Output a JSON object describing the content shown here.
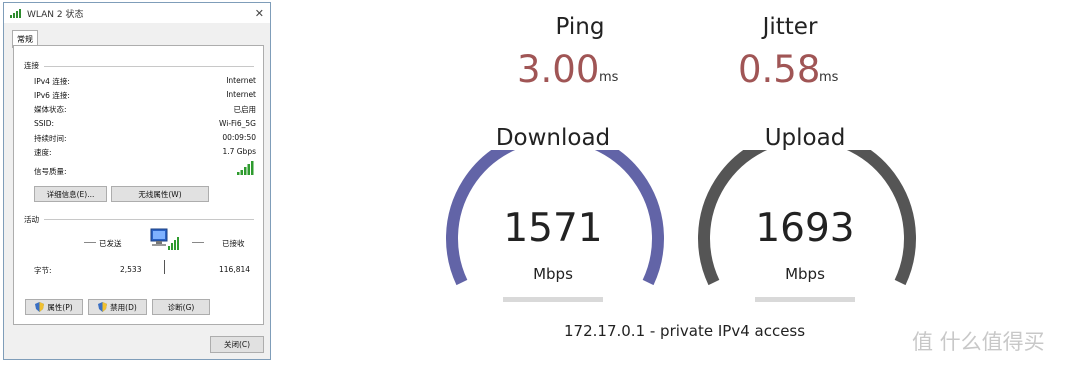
{
  "dialog": {
    "title": "WLAN 2 状态",
    "tab": "常规",
    "connection_group": "连接",
    "rows": [
      {
        "label": "IPv4 连接:",
        "value": "Internet"
      },
      {
        "label": "IPv6 连接:",
        "value": "Internet"
      },
      {
        "label": "媒体状态:",
        "value": "已启用"
      },
      {
        "label": "SSID:",
        "value": "Wi-Fi6_5G"
      },
      {
        "label": "持续时间:",
        "value": "00:09:50"
      },
      {
        "label": "速度:",
        "value": "1.7 Gbps"
      },
      {
        "label": "信号质量:",
        "value": ""
      }
    ],
    "details_button": "详细信息(E)...",
    "wireless_props_button": "无线属性(W)",
    "activity_group": "活动",
    "sent_label": "已发送",
    "received_label": "已接收",
    "bytes_label": "字节:",
    "bytes_sent": "2,533",
    "bytes_received": "116,814",
    "properties_button": "属性(P)",
    "disable_button": "禁用(D)",
    "diagnose_button": "诊断(G)",
    "close_button": "关闭(C)"
  },
  "speedtest": {
    "ping_label": "Ping",
    "ping_value": "3.00",
    "ping_unit": "ms",
    "jitter_label": "Jitter",
    "jitter_value": "0.58",
    "jitter_unit": "ms",
    "download_label": "Download",
    "download_value": "1571",
    "download_unit": "Mbps",
    "upload_label": "Upload",
    "upload_value": "1693",
    "upload_unit": "Mbps",
    "ip_info": "172.17.0.1 - private IPv4 access",
    "colors": {
      "download_arc": "#6264a7",
      "upload_arc": "#555555",
      "value_red": "#a05555"
    }
  },
  "watermark": "值 什么值得买"
}
